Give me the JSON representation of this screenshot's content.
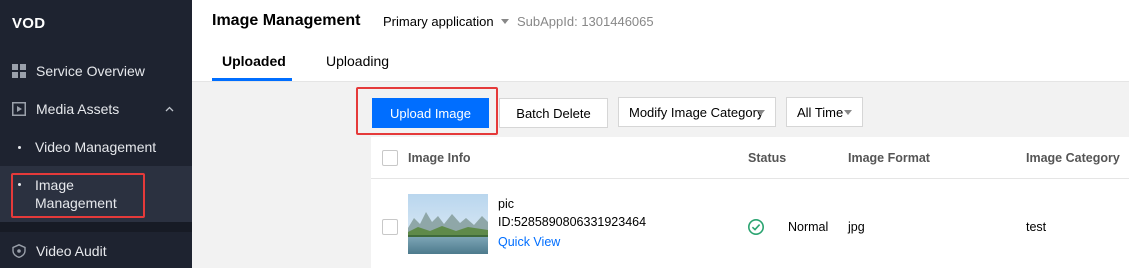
{
  "sidebar": {
    "brand": "VOD",
    "items": [
      {
        "label": "Service Overview",
        "icon": "grid-icon"
      },
      {
        "label": "Media Assets",
        "icon": "play-box-icon"
      },
      {
        "label": "Video Management"
      },
      {
        "label": "Image Management",
        "line1": "Image",
        "line2": "Management",
        "active": true
      },
      {
        "label": "Video Audit",
        "icon": "shield-icon"
      }
    ]
  },
  "header": {
    "title": "Image Management",
    "app_select": "Primary application",
    "subapp": "SubAppId: 1301446065",
    "tabs": [
      {
        "label": "Uploaded",
        "active": true
      },
      {
        "label": "Uploading",
        "active": false
      }
    ]
  },
  "toolbar": {
    "upload_label": "Upload Image",
    "batch_delete_label": "Batch Delete",
    "category_select": "Modify Image Category",
    "time_select": "All Time"
  },
  "table": {
    "columns": [
      "Image Info",
      "Status",
      "Image Format",
      "Image Category"
    ],
    "rows": [
      {
        "name": "pic",
        "id": "ID:5285890806331923464",
        "action": "Quick View",
        "status": "Normal",
        "format": "jpg",
        "category": "test"
      }
    ]
  },
  "colors": {
    "primary": "#006eff",
    "sidebar_bg": "#1e2330",
    "highlight": "#e53a3a",
    "status_ok": "#2ba471"
  }
}
